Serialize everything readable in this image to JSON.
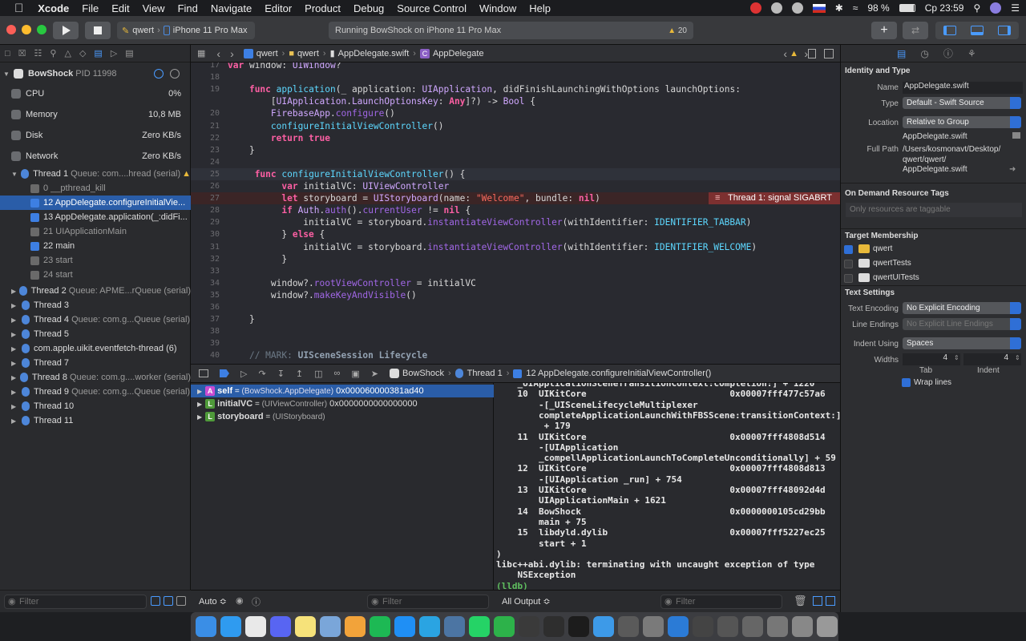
{
  "menubar": {
    "app": "Xcode",
    "items": [
      "File",
      "Edit",
      "View",
      "Find",
      "Navigate",
      "Editor",
      "Product",
      "Debug",
      "Source Control",
      "Window",
      "Help"
    ],
    "battery": "98 %",
    "clock": "Ср 23:59"
  },
  "toolbar": {
    "scheme": "qwert",
    "device": "iPhone 11 Pro Max",
    "activity": "Running BowShock on iPhone 11 Pro Max",
    "warning_count": "20"
  },
  "navigator": {
    "process": "BowShock",
    "pid": "PID 11998",
    "gauges": [
      {
        "label": "CPU",
        "value": "0%"
      },
      {
        "label": "Memory",
        "value": "10,8 MB"
      },
      {
        "label": "Disk",
        "value": "Zero KB/s"
      },
      {
        "label": "Network",
        "value": "Zero KB/s"
      }
    ],
    "thread1": {
      "name": "Thread 1",
      "queue": "Queue: com....hread (serial)"
    },
    "frames": [
      {
        "label": "0 __pthread_kill",
        "dim": true,
        "selected": false,
        "blue": false
      },
      {
        "label": "12 AppDelegate.configureInitialVie...",
        "dim": false,
        "selected": true,
        "blue": true
      },
      {
        "label": "13 AppDelegate.application(_:didFi...",
        "dim": false,
        "selected": false,
        "blue": true
      },
      {
        "label": "21 UIApplicationMain",
        "dim": true,
        "selected": false,
        "blue": false
      },
      {
        "label": "22 main",
        "dim": false,
        "selected": false,
        "blue": true
      },
      {
        "label": "23 start",
        "dim": true,
        "selected": false,
        "blue": false
      },
      {
        "label": "24 start",
        "dim": true,
        "selected": false,
        "blue": false
      }
    ],
    "threads": [
      {
        "name": "Thread 2",
        "queue": "Queue: APME...rQueue (serial)"
      },
      {
        "name": "Thread 3",
        "queue": ""
      },
      {
        "name": "Thread 4",
        "queue": "Queue: com.g...Queue (serial)"
      },
      {
        "name": "Thread 5",
        "queue": ""
      },
      {
        "name": "com.apple.uikit.eventfetch-thread (6)",
        "queue": ""
      },
      {
        "name": "Thread 7",
        "queue": ""
      },
      {
        "name": "Thread 8",
        "queue": "Queue: com.g....worker (serial)"
      },
      {
        "name": "Thread 9",
        "queue": "Queue: com.g...Queue (serial)"
      },
      {
        "name": "Thread 10",
        "queue": ""
      },
      {
        "name": "Thread 11",
        "queue": ""
      }
    ],
    "filter_placeholder": "Filter"
  },
  "jumpbar": {
    "project": "qwert",
    "folder": "qwert",
    "file": "AppDelegate.swift",
    "symbol": "AppDelegate"
  },
  "code": {
    "lines": [
      {
        "n": "17",
        "html": "<span class='kw'>var</span> window: <span class='ty'>UIWindow</span>?",
        "cls": ""
      },
      {
        "n": "18",
        "html": "",
        "cls": ""
      },
      {
        "n": "19",
        "html": "    <span class='kw'>func</span> <span class='fn'>application</span>(_ application: <span class='ty'>UIApplication</span>, didFinishLaunchingWithOptions launchOptions:",
        "cls": ""
      },
      {
        "n": "",
        "html": "        [<span class='ty'>UIApplication</span>.<span class='ty'>LaunchOptionsKey</span>: <span class='kw'>Any</span>]?) -> <span class='ty'>Bool</span> {",
        "cls": ""
      },
      {
        "n": "20",
        "html": "        <span class='ty'>FirebaseApp</span>.<span class='mth'>configure</span>()",
        "cls": ""
      },
      {
        "n": "21",
        "html": "        <span class='fn'>configureInitialViewController</span>()",
        "cls": ""
      },
      {
        "n": "22",
        "html": "        <span class='kw'>return</span> <span class='kw'>true</span>",
        "cls": ""
      },
      {
        "n": "23",
        "html": "    }",
        "cls": ""
      },
      {
        "n": "24",
        "html": "",
        "cls": ""
      },
      {
        "n": "25",
        "html": "     <span class='kw'>func</span> <span class='fn'>configureInitialViewController</span>() {",
        "cls": "curline"
      },
      {
        "n": "26",
        "html": "          <span class='kw'>var</span> initialVC: <span class='ty'>UIViewController</span>",
        "cls": ""
      },
      {
        "n": "27",
        "html": "          <span class='kw'>let</span> storyboard = <span class='ty'>UIStoryboard</span>(name: <span class='st'>\"Welcome\"</span>, bundle: <span class='kw'>nil</span>)",
        "cls": "errline"
      },
      {
        "n": "28",
        "html": "          <span class='kw'>if</span> <span class='ty'>Auth</span>.<span class='mth'>auth</span>().<span class='mth'>currentUser</span> != <span class='kw'>nil</span> {",
        "cls": ""
      },
      {
        "n": "29",
        "html": "              initialVC = storyboard.<span class='mth'>instantiateViewController</span>(withIdentifier: <span class='fn'>IDENTIFIER_TABBAR</span>)",
        "cls": ""
      },
      {
        "n": "30",
        "html": "          } <span class='kw'>else</span> {",
        "cls": ""
      },
      {
        "n": "31",
        "html": "              initialVC = storyboard.<span class='mth'>instantiateViewController</span>(withIdentifier: <span class='fn'>IDENTIFIER_WELCOME</span>)",
        "cls": ""
      },
      {
        "n": "32",
        "html": "          }",
        "cls": ""
      },
      {
        "n": "33",
        "html": "",
        "cls": ""
      },
      {
        "n": "34",
        "html": "        window?.<span class='mth'>rootViewController</span> = initialVC",
        "cls": ""
      },
      {
        "n": "35",
        "html": "        window?.<span class='mth'>makeKeyAndVisible</span>()",
        "cls": ""
      },
      {
        "n": "36",
        "html": "",
        "cls": ""
      },
      {
        "n": "37",
        "html": "    }",
        "cls": ""
      },
      {
        "n": "38",
        "html": "",
        "cls": ""
      },
      {
        "n": "39",
        "html": "",
        "cls": ""
      },
      {
        "n": "40",
        "html": "    <span class='cm'>// MARK: </span><span class='mk'>UISceneSession Lifecycle</span>",
        "cls": ""
      }
    ],
    "error_badge": "Thread 1: signal SIGABRT"
  },
  "debugbar": {
    "process": "BowShock",
    "thread": "Thread 1",
    "frame": "12 AppDelegate.configureInitialViewController()"
  },
  "variables": [
    {
      "badge": "A",
      "color": "#c94cd1",
      "name": "self",
      "type": "(BowShock.AppDelegate)",
      "value": "0x000060000381ad40",
      "selected": true
    },
    {
      "badge": "L",
      "color": "#4f9a3a",
      "name": "initialVC",
      "type": "(UIViewController)",
      "value": "0x0000000000000000",
      "selected": false
    },
    {
      "badge": "L",
      "color": "#4f9a3a",
      "name": "storyboard",
      "type": "(UIStoryboard)",
      "value": "",
      "selected": false
    }
  ],
  "console": {
    "lines": [
      "    _UIApplicationSceneTransitionContext:completion:] + 1220",
      "    10  UIKitCore                           0x00007fff477c57a6",
      "        -[_UISceneLifecycleMultiplexer",
      "        completeApplicationLaunchWithFBSScene:transitionContext:]",
      "         + 179",
      "    11  UIKitCore                           0x00007fff4808d514",
      "        -[UIApplication",
      "        _compellApplicationLaunchToCompleteUnconditionally] + 59",
      "    12  UIKitCore                           0x00007fff4808d813",
      "        -[UIApplication _run] + 754",
      "    13  UIKitCore                           0x00007fff48092d4d",
      "        UIApplicationMain + 1621",
      "    14  BowShock                            0x0000000105cd29bb",
      "        main + 75",
      "    15  libdyld.dylib                       0x00007fff5227ec25",
      "        start + 1",
      ")",
      "libc++abi.dylib: terminating with uncaught exception of type",
      "    NSException",
      "(lldb)"
    ]
  },
  "bottom": {
    "auto": "Auto ≎",
    "filter": "Filter",
    "all_output": "All Output ≎"
  },
  "inspector": {
    "identity_title": "Identity and Type",
    "name_label": "Name",
    "name_value": "AppDelegate.swift",
    "type_label": "Type",
    "type_value": "Default - Swift Source",
    "location_label": "Location",
    "location_value": "Relative to Group",
    "location_file": "AppDelegate.swift",
    "fullpath_label": "Full Path",
    "fullpath_1": "/Users/kosmonavt/Desktop/",
    "fullpath_2": "qwert/qwert/",
    "fullpath_3": "AppDelegate.swift",
    "odr_title": "On Demand Resource Tags",
    "odr_placeholder": "Only resources are taggable",
    "target_title": "Target Membership",
    "targets": [
      {
        "name": "qwert",
        "checked": true
      },
      {
        "name": "qwertTests",
        "checked": false
      },
      {
        "name": "qwertUITests",
        "checked": false
      }
    ],
    "text_title": "Text Settings",
    "encoding_label": "Text Encoding",
    "encoding_value": "No Explicit Encoding",
    "endings_label": "Line Endings",
    "endings_value": "No Explicit Line Endings",
    "indent_label": "Indent Using",
    "indent_value": "Spaces",
    "widths_label": "Widths",
    "tab_width": "4",
    "indent_width": "4",
    "tab_label": "Tab",
    "indent_label2": "Indent",
    "wrap_label": "Wrap lines"
  },
  "dock": {
    "colors": [
      "#3a8ee6",
      "#2f9bf0",
      "#e9e9e9",
      "#5865f2",
      "#f6e27a",
      "#7aa6d9",
      "#f2a33a",
      "#1db954",
      "#1f8ff5",
      "#2aa4e2",
      "#4c75a3",
      "#25d366",
      "#2db24a",
      "#3a3a3a",
      "#2e2e2e",
      "#1c1c1c",
      "#3d9ae8",
      "#5a5a5a",
      "#7a7a7a",
      "#2b7bd6",
      "#444",
      "#555",
      "#666",
      "#777",
      "#888",
      "#999"
    ]
  }
}
